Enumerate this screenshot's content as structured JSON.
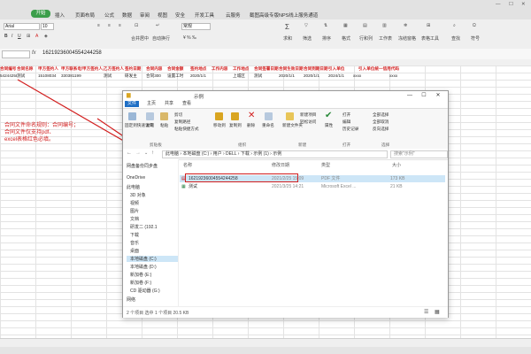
{
  "spreadsheet": {
    "open_label": "开始",
    "menu": [
      "插入",
      "页面布局",
      "公式",
      "数据",
      "审阅",
      "视图",
      "安全",
      "开发工具",
      "云服务",
      "截图高级专版NPS线上服务通道"
    ],
    "font_name": "Arial",
    "font_size": "10",
    "ribbon_labels": {
      "merge_center": "合并居中",
      "auto_wrap": "自动换行",
      "normal": "常规",
      "sum": "求和",
      "filter": "筛选",
      "sort": "排序",
      "format": "格式",
      "row_col": "行和列",
      "worksheet": "工作表",
      "freeze": "冻结窗格",
      "table_tools": "表格工具",
      "find": "查找",
      "symbol": "符号"
    },
    "formula": {
      "fx": "fx",
      "text": "16219236004554244258"
    },
    "header_cells": [
      "合同编号",
      "合同名称",
      "甲方签约人",
      "甲方联系电话",
      "甲方签约人身份证",
      "乙方签约人",
      "签约日期",
      "合同内容",
      "合同金额",
      "签约地点",
      "工作内容",
      "工作地点",
      "合同签署日期",
      "合同生效日期",
      "合同到期日期",
      "引入单位",
      "引入单位统一信用代码"
    ],
    "data_cells": [
      "54244258",
      "测试",
      "15108034",
      "330381199",
      "测试",
      "研发主",
      "合同300",
      "设置工时",
      "2020/1/1",
      "上城区",
      "测试",
      "2020/1/1",
      "2020/1/1",
      "2024/1/1",
      "xxxx",
      "xxxx"
    ],
    "annotation_lines": [
      "合同文件命名规则：合同编号；",
      "合同文件仅支持pdf、",
      "excel表格红色必填。"
    ]
  },
  "explorer": {
    "title": "示例",
    "tabs": [
      "文件",
      "主页",
      "共享",
      "查看"
    ],
    "ribbon": {
      "pin_quick": "固定到快速访问",
      "copy": "复制",
      "paste": "粘贴",
      "cut": "剪切",
      "copy_path": "复制路径",
      "paste_shortcut": "粘贴快捷方式",
      "move_to": "移动到",
      "copy_to": "复制到",
      "delete": "删除",
      "rename": "重命名",
      "new_folder": "新建文件夹",
      "new_item": "新建项目",
      "easy_access": "轻松访问",
      "properties": "属性",
      "open": "打开",
      "edit": "编辑",
      "history": "历史记录",
      "select_all": "全部选择",
      "select_none": "全部取消",
      "invert": "反向选择",
      "group_clipboard": "剪贴板",
      "group_organize": "组织",
      "group_new": "新建",
      "group_open": "打开",
      "group_select": "选择"
    },
    "address": "此电脑 › 本地磁盘 (C:) › 用户 › DELL › 下载 › 示例 (1) › 示例",
    "search_placeholder": "搜索\"示例\"",
    "nav": [
      "网盘备份同步盘",
      "OneDrive",
      "此电脑",
      "3D 对象",
      "视频",
      "图片",
      "文档",
      "研发二 (192.1",
      "下载",
      "音乐",
      "桌面",
      "本地磁盘 (C:)",
      "本地磁盘 (D:)",
      "新加卷 (E:)",
      "新加卷 (F:)",
      "CD 驱动器 (G:)",
      "网络"
    ],
    "columns": [
      "名称",
      "修改日期",
      "类型",
      "大小"
    ],
    "files": [
      {
        "name": "16219236004554244258",
        "date": "2021/2/25 15:09",
        "type": "PDF 文件",
        "size": "173 KB"
      },
      {
        "name": "测试",
        "date": "2021/3/25 14:21",
        "type": "Microsoft Excel ...",
        "size": "21 KB"
      }
    ],
    "status": "2 个项目    选中 1 个项目  20.5 KB"
  },
  "colors": {
    "accent_red": "#d21e1e",
    "wps_green": "#3b9e4a",
    "explorer_blue": "#1f6fc5"
  }
}
